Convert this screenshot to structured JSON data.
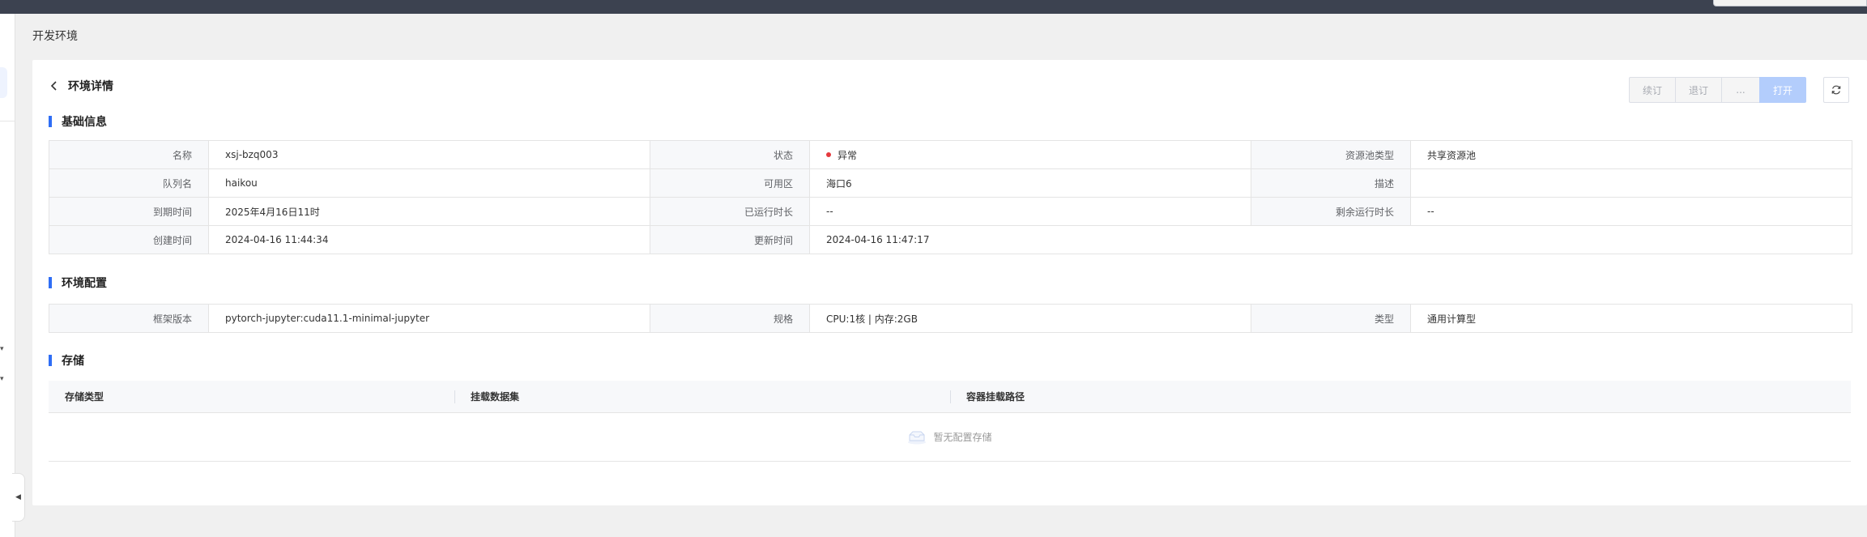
{
  "page": {
    "title": "开发环境"
  },
  "detail": {
    "back_title": "环境详情"
  },
  "toolbar": {
    "renew_label": "续订",
    "unsubscribe_label": "退订",
    "more_label": "...",
    "open_label": "打开"
  },
  "sections": {
    "basic": "基础信息",
    "config": "环境配置",
    "storage": "存储"
  },
  "basic_info": {
    "name_label": "名称",
    "name": "xsj-bzq003",
    "status_label": "状态",
    "status": "异常",
    "pool_type_label": "资源池类型",
    "pool_type": "共享资源池",
    "queue_label": "队列名",
    "queue": "haikou",
    "zone_label": "可用区",
    "zone": "海口6",
    "desc_label": "描述",
    "desc": "",
    "expire_label": "到期时间",
    "expire": "2025年4月16日11时",
    "runtime_label": "已运行时长",
    "runtime": "--",
    "remaining_label": "剩余运行时长",
    "remaining": "--",
    "created_label": "创建时间",
    "created": "2024-04-16 11:44:34",
    "updated_label": "更新时间",
    "updated": "2024-04-16 11:47:17"
  },
  "env_config": {
    "framework_label": "框架版本",
    "framework": "pytorch-jupyter:cuda11.1-minimal-jupyter",
    "spec_label": "规格",
    "spec": "CPU:1核 | 内存:2GB",
    "type_label": "类型",
    "type": "通用计算型"
  },
  "storage": {
    "columns": [
      "存储类型",
      "挂载数据集",
      "容器挂载路径"
    ],
    "empty_text": "暂无配置存储"
  },
  "colors": {
    "accent": "#2f6ef5",
    "status_error": "#e5393d",
    "topbar": "#3c4250"
  }
}
